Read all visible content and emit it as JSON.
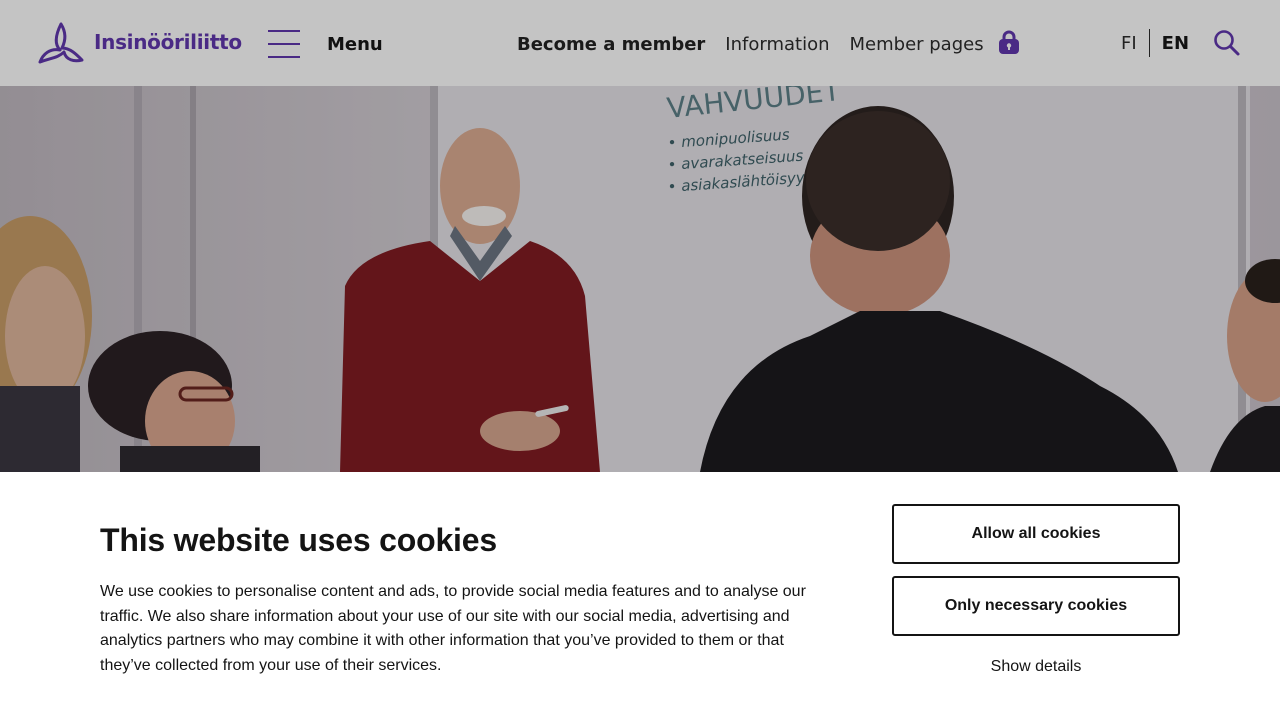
{
  "header": {
    "logo_text": "Insinööriliitto",
    "menu_label": "Menu",
    "nav": {
      "become_member": "Become a member",
      "information": "Information",
      "member_pages": "Member pages"
    },
    "lang": {
      "fi": "FI",
      "en": "EN",
      "active": "EN"
    },
    "icons": [
      "logo-icon",
      "hamburger-icon",
      "lock-icon",
      "search-icon"
    ]
  },
  "hero": {
    "whiteboard_heading": "VAHVUUDET",
    "whiteboard_lines": [
      "• monipuolisuus",
      "• avarakatseisuus",
      "• asiakaslähtöisyys"
    ]
  },
  "cookie_banner": {
    "title": "This website uses cookies",
    "text": "We use cookies to personalise content and ads, to provide social media features and to analyse our traffic. We also share information about your use of our site with our social media, advertising and analytics partners who may combine it with other information that you’ve provided to them or that they’ve collected from your use of their services.",
    "allow_all_label": "Allow all cookies",
    "necessary_label": "Only necessary cookies",
    "show_details_label": "Show details"
  },
  "colors": {
    "brand_purple": "#4a2a85",
    "header_bg": "#c4c4c4",
    "text_dark": "#141414"
  }
}
